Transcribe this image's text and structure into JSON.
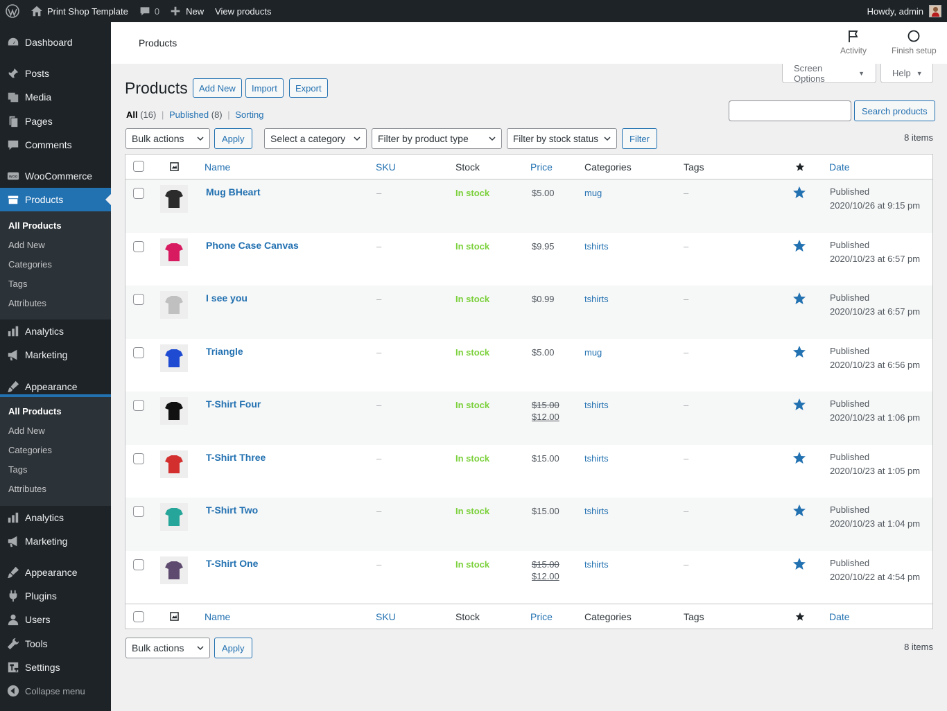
{
  "adminbar": {
    "site_name": "Print Shop Template",
    "comments_count": "0",
    "new_label": "New",
    "view_label": "View products",
    "howdy": "Howdy, admin"
  },
  "sidebar": {
    "dashboard": "Dashboard",
    "posts": "Posts",
    "media": "Media",
    "pages": "Pages",
    "comments": "Comments",
    "woocommerce": "WooCommerce",
    "products": "Products",
    "submenu1": [
      "All Products",
      "Add New",
      "Categories",
      "Tags",
      "Attributes"
    ],
    "analytics": "Analytics",
    "marketing": "Marketing",
    "appearance": "Appearance",
    "submenu2": [
      "All Products",
      "Add New",
      "Categories",
      "Tags",
      "Attributes"
    ],
    "analytics2": "Analytics",
    "marketing2": "Marketing",
    "appearance2": "Appearance",
    "plugins": "Plugins",
    "users": "Users",
    "tools": "Tools",
    "settings": "Settings",
    "collapse": "Collapse menu"
  },
  "header": {
    "title": "Products",
    "activity": "Activity",
    "finish_setup": "Finish setup",
    "screen_options": "Screen Options",
    "help": "Help"
  },
  "page": {
    "heading": "Products",
    "add_new": "Add New",
    "import": "Import",
    "export": "Export",
    "views": {
      "all": "All",
      "all_count": "(16)",
      "published": "Published",
      "published_count": "(8)",
      "sorting": "Sorting"
    },
    "search_button": "Search products",
    "search_placeholder": "",
    "bulk_actions": "Bulk actions",
    "apply": "Apply",
    "select_category": "Select a category",
    "filter_type": "Filter by product type",
    "filter_stock": "Filter by stock status",
    "filter": "Filter",
    "items_count": "8 items"
  },
  "table": {
    "columns": {
      "name": "Name",
      "sku": "SKU",
      "stock": "Stock",
      "price": "Price",
      "categories": "Categories",
      "tags": "Tags",
      "date": "Date"
    },
    "rows": [
      {
        "name": "Mug BHeart",
        "sku": "–",
        "stock": "In stock",
        "price": "$5.00",
        "price_old": "",
        "category": "mug",
        "tags": "–",
        "status": "Published",
        "date": "2020/10/26 at 9:15 pm",
        "thumb": "#2b2b2b"
      },
      {
        "name": "Phone Case Canvas",
        "sku": "–",
        "stock": "In stock",
        "price": "$9.95",
        "price_old": "",
        "category": "tshirts",
        "tags": "–",
        "status": "Published",
        "date": "2020/10/23 at 6:57 pm",
        "thumb": "#d81b60"
      },
      {
        "name": "I see you",
        "sku": "–",
        "stock": "In stock",
        "price": "$0.99",
        "price_old": "",
        "category": "tshirts",
        "tags": "–",
        "status": "Published",
        "date": "2020/10/23 at 6:57 pm",
        "thumb": "#c0c0c0"
      },
      {
        "name": "Triangle",
        "sku": "–",
        "stock": "In stock",
        "price": "$5.00",
        "price_old": "",
        "category": "mug",
        "tags": "–",
        "status": "Published",
        "date": "2020/10/23 at 6:56 pm",
        "thumb": "#1e4bd2"
      },
      {
        "name": "T-Shirt Four",
        "sku": "–",
        "stock": "In stock",
        "price": "$12.00",
        "price_old": "$15.00",
        "category": "tshirts",
        "tags": "–",
        "status": "Published",
        "date": "2020/10/23 at 1:06 pm",
        "thumb": "#111111"
      },
      {
        "name": "T-Shirt Three",
        "sku": "–",
        "stock": "In stock",
        "price": "$15.00",
        "price_old": "",
        "category": "tshirts",
        "tags": "–",
        "status": "Published",
        "date": "2020/10/23 at 1:05 pm",
        "thumb": "#d32f2f"
      },
      {
        "name": "T-Shirt Two",
        "sku": "–",
        "stock": "In stock",
        "price": "$15.00",
        "price_old": "",
        "category": "tshirts",
        "tags": "–",
        "status": "Published",
        "date": "2020/10/23 at 1:04 pm",
        "thumb": "#26a69a"
      },
      {
        "name": "T-Shirt One",
        "sku": "–",
        "stock": "In stock",
        "price": "$12.00",
        "price_old": "$15.00",
        "category": "tshirts",
        "tags": "–",
        "status": "Published",
        "date": "2020/10/22 at 4:54 pm",
        "thumb": "#5e4a6e"
      }
    ]
  },
  "colors": {
    "accent": "#2271b1",
    "sidebar_bg": "#1d2327",
    "in_stock": "#7ad03a"
  }
}
